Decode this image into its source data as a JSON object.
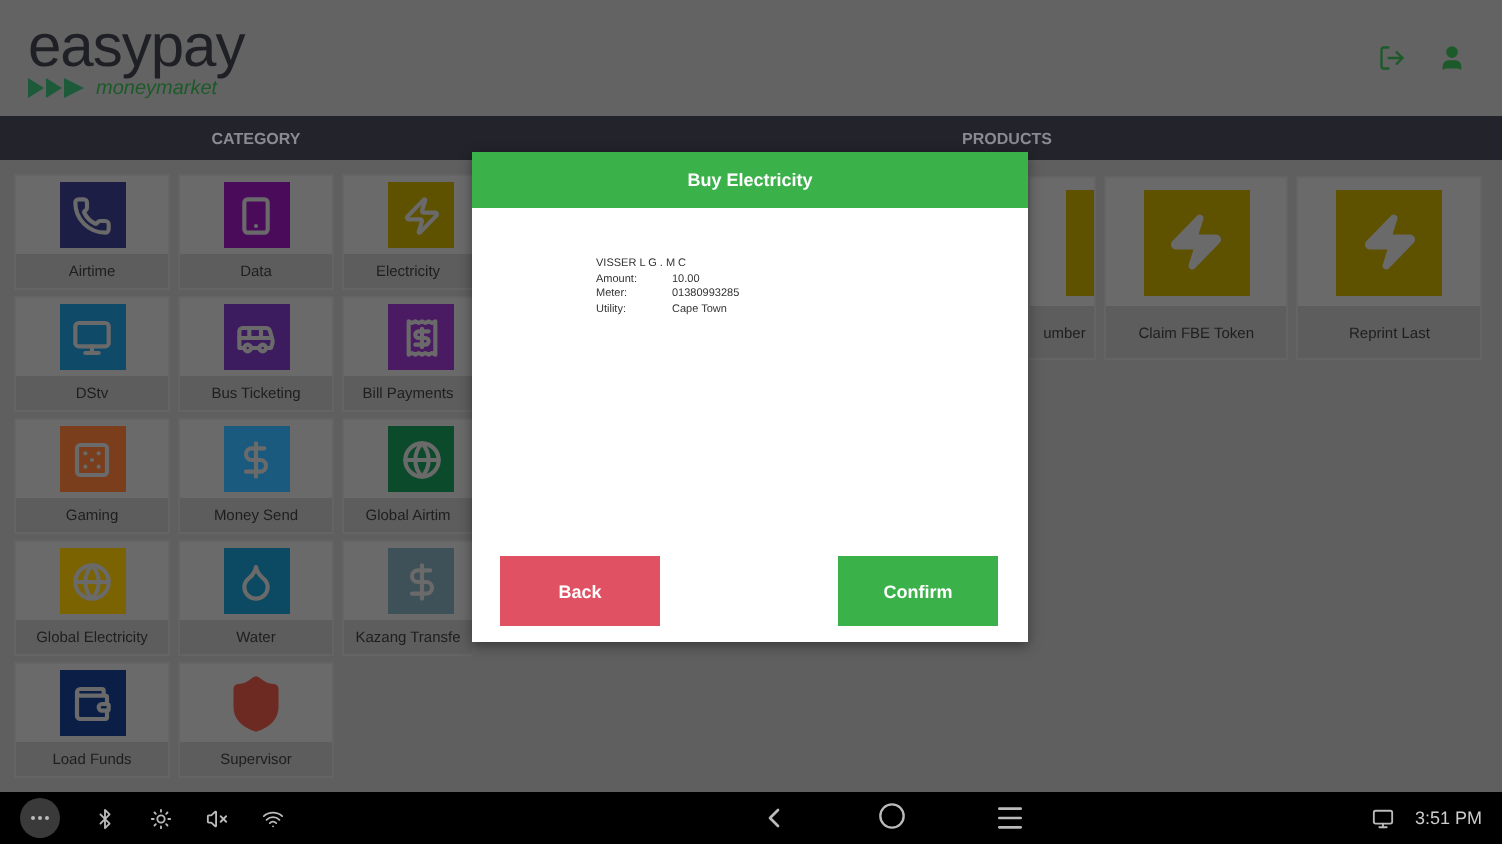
{
  "brand": {
    "name": "**easy**pay",
    "tagline": "moneymarket"
  },
  "category_header": "CATEGORY",
  "products_header": "PRODUCTS",
  "categories": [
    {
      "label": "Airtime",
      "color": "#1d1e45"
    },
    {
      "label": "Data",
      "color": "#4a0c5a"
    },
    {
      "label": "Electricity",
      "color": "#5e5200"
    },
    {
      "label": "DStv",
      "color": "#0f4a68"
    },
    {
      "label": "Bus Ticketing",
      "color": "#3c1b5e"
    },
    {
      "label": "Bill Payments",
      "color": "#4a1a62"
    },
    {
      "label": "Gaming",
      "color": "#7a3e1c"
    },
    {
      "label": "Money Send",
      "color": "#1a5a7e"
    },
    {
      "label": "Global Airtim",
      "color": "#0c4a2c"
    },
    {
      "label": "Global Electricity",
      "color": "#7a6300"
    },
    {
      "label": "Water",
      "color": "#0b4a62"
    },
    {
      "label": "Kazang Transfe",
      "color": "#3e5058"
    },
    {
      "label": "Load Funds",
      "color": "#0b1f46"
    },
    {
      "label": "Supervisor",
      "color": "#6c2a22"
    }
  ],
  "products": [
    {
      "label": "umber"
    },
    {
      "label": "Claim FBE Token"
    },
    {
      "label": "Reprint Last"
    }
  ],
  "dialog": {
    "title": "Buy Electricity",
    "customer": "VISSER L G . M C",
    "details": [
      {
        "label": "Amount:",
        "value": "10.00"
      },
      {
        "label": "Meter:",
        "value": "01380993285"
      },
      {
        "label": "Utility:",
        "value": "Cape Town"
      }
    ],
    "buttons": [
      {
        "label": "Back",
        "kind": "cancel"
      },
      {
        "label": "Confirm",
        "kind": "confirm"
      }
    ]
  },
  "status_bar": {
    "time": "3:51 PM"
  }
}
